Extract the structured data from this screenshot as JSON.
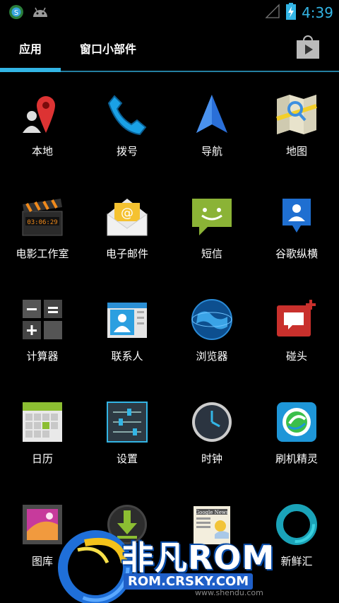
{
  "status_bar": {
    "time": "4:39"
  },
  "tabs": {
    "apps": "应用",
    "widgets": "窗口小部件"
  },
  "apps": [
    {
      "label": "本地"
    },
    {
      "label": "拨号"
    },
    {
      "label": "导航"
    },
    {
      "label": "地图"
    },
    {
      "label": "电影工作室"
    },
    {
      "label": "电子邮件"
    },
    {
      "label": "短信"
    },
    {
      "label": "谷歌纵横"
    },
    {
      "label": "计算器"
    },
    {
      "label": "联系人"
    },
    {
      "label": "浏览器"
    },
    {
      "label": "碰头"
    },
    {
      "label": "日历"
    },
    {
      "label": "设置"
    },
    {
      "label": "时钟"
    },
    {
      "label": "刷机精灵"
    },
    {
      "label": "图库"
    },
    {
      "label": "新鲜汇"
    }
  ],
  "watermark": {
    "brand": "非凡ROM",
    "url": "ROM.CRSKY.COM",
    "small": "www.shendu.com"
  }
}
